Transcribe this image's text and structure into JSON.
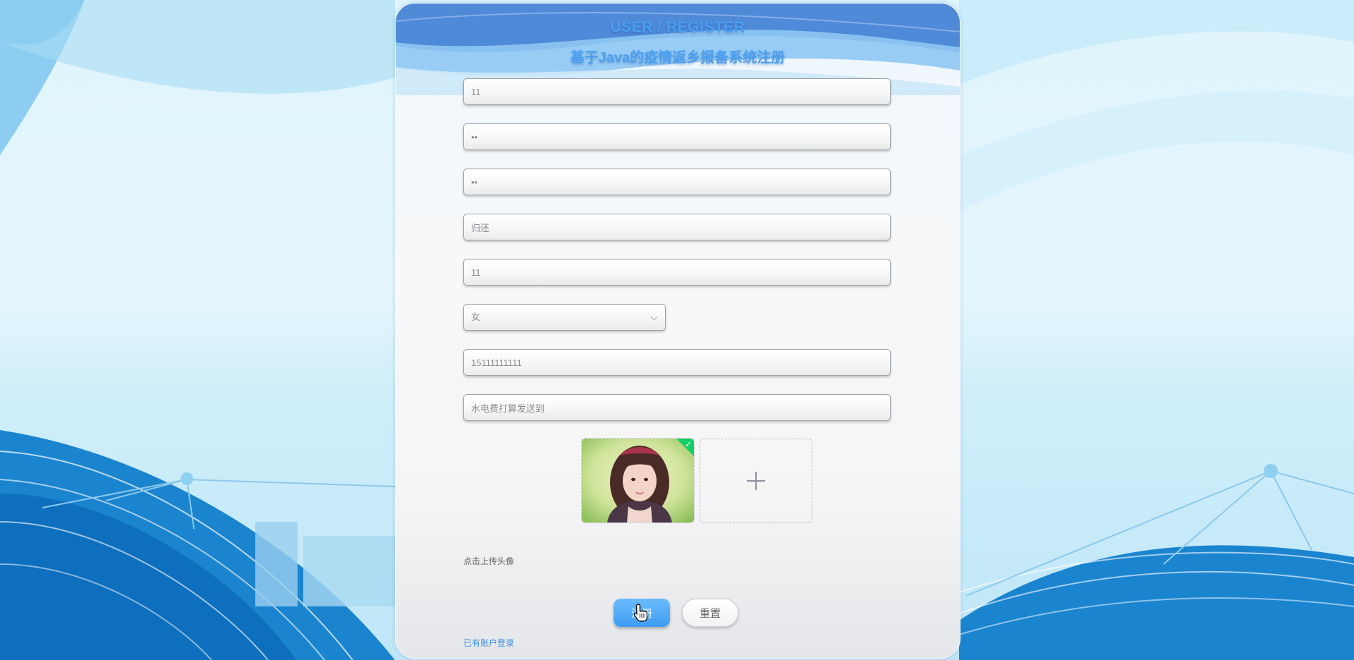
{
  "header": {
    "title_en": "USER / REGISTER",
    "title_cn": "基于Java的疫情返乡报备系统注册"
  },
  "form": {
    "account": "11",
    "password": "••",
    "confirm_password": "••",
    "name": "归还",
    "field_five": "11",
    "gender": "女",
    "phone": "15111111111",
    "address": "水电费打算发送到"
  },
  "upload": {
    "hint": "点击上传头像",
    "status": "uploaded"
  },
  "actions": {
    "register_label": "注册",
    "reset_label": "重置",
    "login_link": "已有账户登录"
  },
  "colors": {
    "accent": "#3d9df2",
    "title": "#4a9ff0",
    "success": "#13ce66",
    "link": "#3a8ee6"
  },
  "icons": [
    "chevron-down-icon",
    "check-icon",
    "plus-icon",
    "hand-cursor-icon"
  ]
}
